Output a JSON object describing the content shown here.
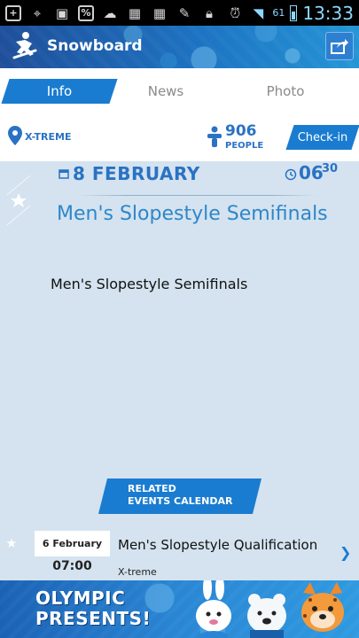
{
  "status_bar": {
    "battery_percent": "61",
    "time": "13:33"
  },
  "header": {
    "title": "Snowboard"
  },
  "tabs": [
    {
      "label": "Info",
      "active": true
    },
    {
      "label": "News",
      "active": false
    },
    {
      "label": "Photo",
      "active": false
    }
  ],
  "info_bar": {
    "location": "X-TREME",
    "people_count": "906",
    "people_label": "PEOPLE",
    "checkin_label": "Check-in"
  },
  "event": {
    "date": "8 FEBRUARY",
    "time_hour": "06",
    "time_minute": "30",
    "title": "Men's Slopestyle Semifinals",
    "description": "Men's Slopestyle Semifinals"
  },
  "related": {
    "heading_line1": "RELATED",
    "heading_line2": "EVENTS CALENDAR",
    "items": [
      {
        "date": "6 February",
        "time": "07:00",
        "title": "Men's Slopestyle Qualification",
        "location": "X-treme"
      }
    ]
  },
  "banner": {
    "line1": "OLYMPIC",
    "line2": "PRESENTS!"
  },
  "colors": {
    "accent_blue": "#1a7cd0",
    "text_blue": "#2a72c4",
    "background": "#d4e3ef"
  }
}
